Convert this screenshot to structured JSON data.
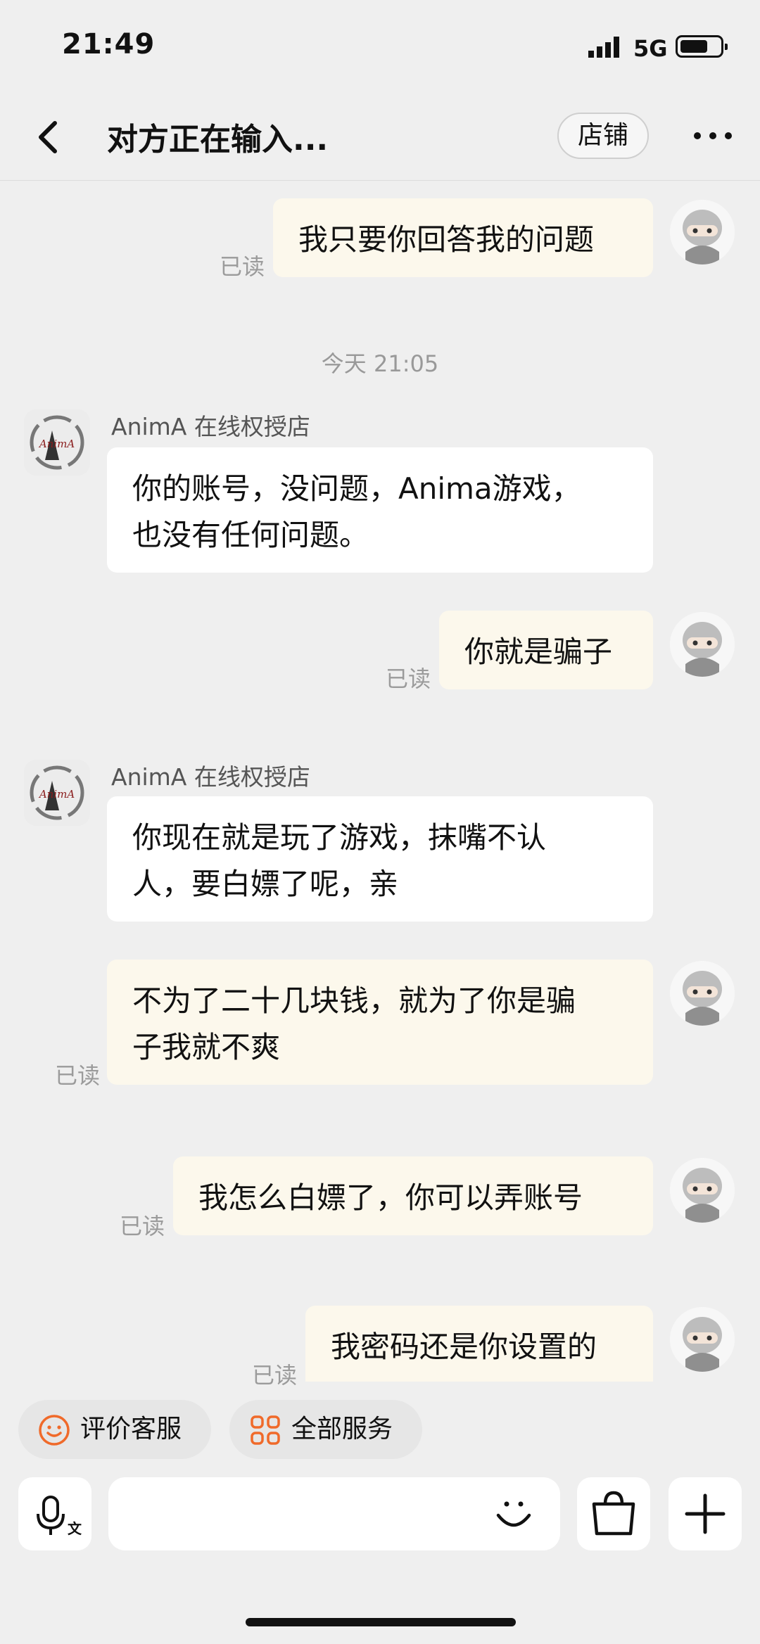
{
  "status_bar": {
    "time": "21:49",
    "network": "5G"
  },
  "header": {
    "title": "对方正在输入...",
    "shop_button": "店铺"
  },
  "chat": {
    "date_divider": "今天 21:05",
    "messages": [
      {
        "sender": "me",
        "text": "我只要你回答我的问题",
        "status": "已读"
      },
      {
        "sender": "shop",
        "name": "AnimA 在线权授店",
        "lines": [
          "你的账号，没问题，Anima游戏，",
          "也没有任何问题。"
        ]
      },
      {
        "sender": "me",
        "text": "你就是骗子",
        "status": "已读"
      },
      {
        "sender": "shop",
        "name": "AnimA 在线权授店",
        "lines": [
          "你现在就是玩了游戏，抹嘴不认",
          "人，要白嫖了呢，亲"
        ]
      },
      {
        "sender": "me",
        "lines": [
          "不为了二十几块钱，就为了你是骗",
          "子我就不爽"
        ],
        "status": "已读"
      },
      {
        "sender": "me",
        "text": "我怎么白嫖了，你可以弄账号",
        "status": "已读"
      },
      {
        "sender": "me",
        "text": "我密码还是你设置的",
        "status": "已读"
      }
    ]
  },
  "quick_actions": [
    {
      "label": "评价客服",
      "icon": "smile-icon"
    },
    {
      "label": "全部服务",
      "icon": "grid-icon"
    }
  ],
  "shop_avatar_text": "AnimA",
  "colors": {
    "accent": "#f06a2a",
    "my_bubble": "#fcf8ec",
    "background": "#efefef"
  }
}
